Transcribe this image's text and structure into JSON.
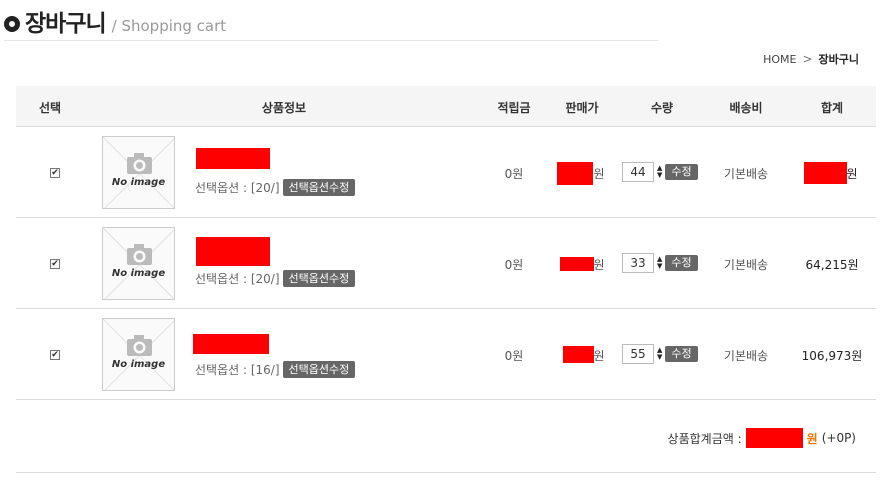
{
  "header": {
    "title": "장바구니",
    "subtitle": "/ Shopping cart"
  },
  "breadcrumb": {
    "home": "HOME",
    "separator": ">",
    "current": "장바구니"
  },
  "columns": [
    "선택",
    "상품정보",
    "적립금",
    "판매가",
    "수량",
    "배송비",
    "합계"
  ],
  "items": [
    {
      "checked": "✔",
      "no_image": "No image",
      "option_label": "선택옵션 : [20/]",
      "option_button": "선택옵션수정",
      "points": "0원",
      "price_suffix": "원",
      "quantity": "44",
      "update_button": "수정",
      "shipping": "기본배송",
      "total": "원"
    },
    {
      "checked": "✔",
      "no_image": "No image",
      "option_label": "선택옵션 : [20/]",
      "option_button": "선택옵션수정",
      "points": "0원",
      "price_suffix": "원",
      "quantity": "33",
      "update_button": "수정",
      "shipping": "기본배송",
      "total": "64,215원"
    },
    {
      "checked": "✔",
      "no_image": "No image",
      "option_label": "선택옵션 : [16/]",
      "option_button": "선택옵션수정",
      "points": "0원",
      "price_suffix": "원",
      "quantity": "55",
      "update_button": "수정",
      "shipping": "기본배송",
      "total": "106,973원"
    }
  ],
  "summary": {
    "label": "상품합계금액 :",
    "won": "원",
    "points": "(+0P)"
  },
  "colors": {
    "redaction": "#ff0000",
    "accent": "#f07800",
    "button": "#666666"
  },
  "icons": {
    "header": "circle-bullet-icon",
    "thumb": "camera-icon",
    "qty": "up-down-arrow-icon"
  }
}
